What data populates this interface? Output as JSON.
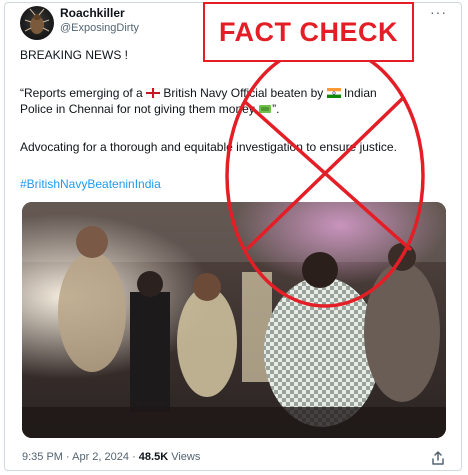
{
  "tweet": {
    "display_name": "Roachkiller",
    "handle": "@ExposingDirty",
    "more_label": "···",
    "line1": "BREAKING NEWS !",
    "line2_a": "“Reports emerging of a",
    "line2_b": "British Navy Official beaten by",
    "line2_c": "Indian",
    "line3_a": "Police in Chennai for not giving them money",
    "line3_b": "”.",
    "line4": "Advocating for a thorough and equitable investigation to ensure justice.",
    "hashtag": "#BritishNavyBeateninIndia",
    "timestamp": "9:35 PM · Apr 2, 2024 ·",
    "views_count": "48.5K",
    "views_label": "Views"
  },
  "overlay": {
    "label": "FACT CHECK",
    "color": "#e41e26"
  },
  "icons": {
    "avatar": "avatar-cockroach-icon",
    "flag_uk": "england-flag-icon",
    "flag_in": "india-flag-icon",
    "money": "money-icon",
    "share": "share-icon"
  }
}
